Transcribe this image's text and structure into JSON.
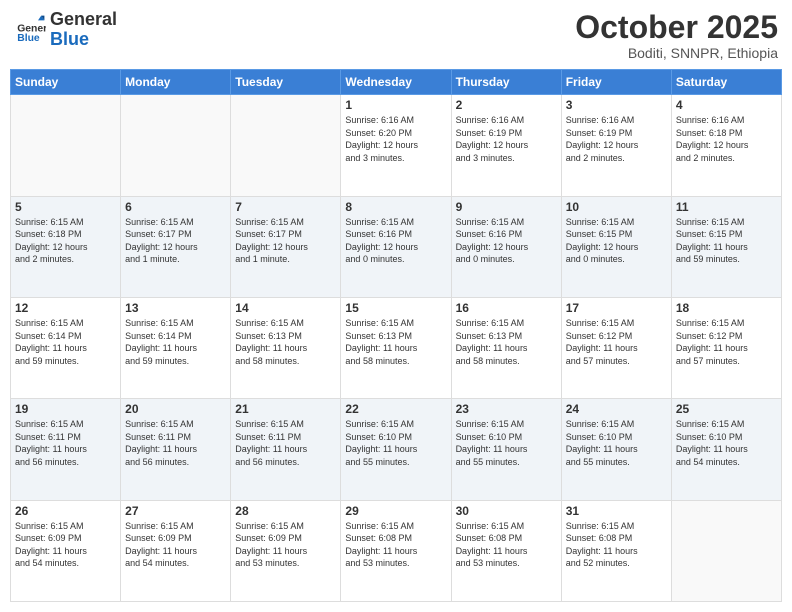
{
  "logo": {
    "line1": "General",
    "line2": "Blue"
  },
  "title": "October 2025",
  "subtitle": "Boditi, SNNPR, Ethiopia",
  "days_header": [
    "Sunday",
    "Monday",
    "Tuesday",
    "Wednesday",
    "Thursday",
    "Friday",
    "Saturday"
  ],
  "weeks": [
    [
      {
        "day": "",
        "info": ""
      },
      {
        "day": "",
        "info": ""
      },
      {
        "day": "",
        "info": ""
      },
      {
        "day": "1",
        "info": "Sunrise: 6:16 AM\nSunset: 6:20 PM\nDaylight: 12 hours\nand 3 minutes."
      },
      {
        "day": "2",
        "info": "Sunrise: 6:16 AM\nSunset: 6:19 PM\nDaylight: 12 hours\nand 3 minutes."
      },
      {
        "day": "3",
        "info": "Sunrise: 6:16 AM\nSunset: 6:19 PM\nDaylight: 12 hours\nand 2 minutes."
      },
      {
        "day": "4",
        "info": "Sunrise: 6:16 AM\nSunset: 6:18 PM\nDaylight: 12 hours\nand 2 minutes."
      }
    ],
    [
      {
        "day": "5",
        "info": "Sunrise: 6:15 AM\nSunset: 6:18 PM\nDaylight: 12 hours\nand 2 minutes."
      },
      {
        "day": "6",
        "info": "Sunrise: 6:15 AM\nSunset: 6:17 PM\nDaylight: 12 hours\nand 1 minute."
      },
      {
        "day": "7",
        "info": "Sunrise: 6:15 AM\nSunset: 6:17 PM\nDaylight: 12 hours\nand 1 minute."
      },
      {
        "day": "8",
        "info": "Sunrise: 6:15 AM\nSunset: 6:16 PM\nDaylight: 12 hours\nand 0 minutes."
      },
      {
        "day": "9",
        "info": "Sunrise: 6:15 AM\nSunset: 6:16 PM\nDaylight: 12 hours\nand 0 minutes."
      },
      {
        "day": "10",
        "info": "Sunrise: 6:15 AM\nSunset: 6:15 PM\nDaylight: 12 hours\nand 0 minutes."
      },
      {
        "day": "11",
        "info": "Sunrise: 6:15 AM\nSunset: 6:15 PM\nDaylight: 11 hours\nand 59 minutes."
      }
    ],
    [
      {
        "day": "12",
        "info": "Sunrise: 6:15 AM\nSunset: 6:14 PM\nDaylight: 11 hours\nand 59 minutes."
      },
      {
        "day": "13",
        "info": "Sunrise: 6:15 AM\nSunset: 6:14 PM\nDaylight: 11 hours\nand 59 minutes."
      },
      {
        "day": "14",
        "info": "Sunrise: 6:15 AM\nSunset: 6:13 PM\nDaylight: 11 hours\nand 58 minutes."
      },
      {
        "day": "15",
        "info": "Sunrise: 6:15 AM\nSunset: 6:13 PM\nDaylight: 11 hours\nand 58 minutes."
      },
      {
        "day": "16",
        "info": "Sunrise: 6:15 AM\nSunset: 6:13 PM\nDaylight: 11 hours\nand 58 minutes."
      },
      {
        "day": "17",
        "info": "Sunrise: 6:15 AM\nSunset: 6:12 PM\nDaylight: 11 hours\nand 57 minutes."
      },
      {
        "day": "18",
        "info": "Sunrise: 6:15 AM\nSunset: 6:12 PM\nDaylight: 11 hours\nand 57 minutes."
      }
    ],
    [
      {
        "day": "19",
        "info": "Sunrise: 6:15 AM\nSunset: 6:11 PM\nDaylight: 11 hours\nand 56 minutes."
      },
      {
        "day": "20",
        "info": "Sunrise: 6:15 AM\nSunset: 6:11 PM\nDaylight: 11 hours\nand 56 minutes."
      },
      {
        "day": "21",
        "info": "Sunrise: 6:15 AM\nSunset: 6:11 PM\nDaylight: 11 hours\nand 56 minutes."
      },
      {
        "day": "22",
        "info": "Sunrise: 6:15 AM\nSunset: 6:10 PM\nDaylight: 11 hours\nand 55 minutes."
      },
      {
        "day": "23",
        "info": "Sunrise: 6:15 AM\nSunset: 6:10 PM\nDaylight: 11 hours\nand 55 minutes."
      },
      {
        "day": "24",
        "info": "Sunrise: 6:15 AM\nSunset: 6:10 PM\nDaylight: 11 hours\nand 55 minutes."
      },
      {
        "day": "25",
        "info": "Sunrise: 6:15 AM\nSunset: 6:10 PM\nDaylight: 11 hours\nand 54 minutes."
      }
    ],
    [
      {
        "day": "26",
        "info": "Sunrise: 6:15 AM\nSunset: 6:09 PM\nDaylight: 11 hours\nand 54 minutes."
      },
      {
        "day": "27",
        "info": "Sunrise: 6:15 AM\nSunset: 6:09 PM\nDaylight: 11 hours\nand 54 minutes."
      },
      {
        "day": "28",
        "info": "Sunrise: 6:15 AM\nSunset: 6:09 PM\nDaylight: 11 hours\nand 53 minutes."
      },
      {
        "day": "29",
        "info": "Sunrise: 6:15 AM\nSunset: 6:08 PM\nDaylight: 11 hours\nand 53 minutes."
      },
      {
        "day": "30",
        "info": "Sunrise: 6:15 AM\nSunset: 6:08 PM\nDaylight: 11 hours\nand 53 minutes."
      },
      {
        "day": "31",
        "info": "Sunrise: 6:15 AM\nSunset: 6:08 PM\nDaylight: 11 hours\nand 52 minutes."
      },
      {
        "day": "",
        "info": ""
      }
    ]
  ]
}
